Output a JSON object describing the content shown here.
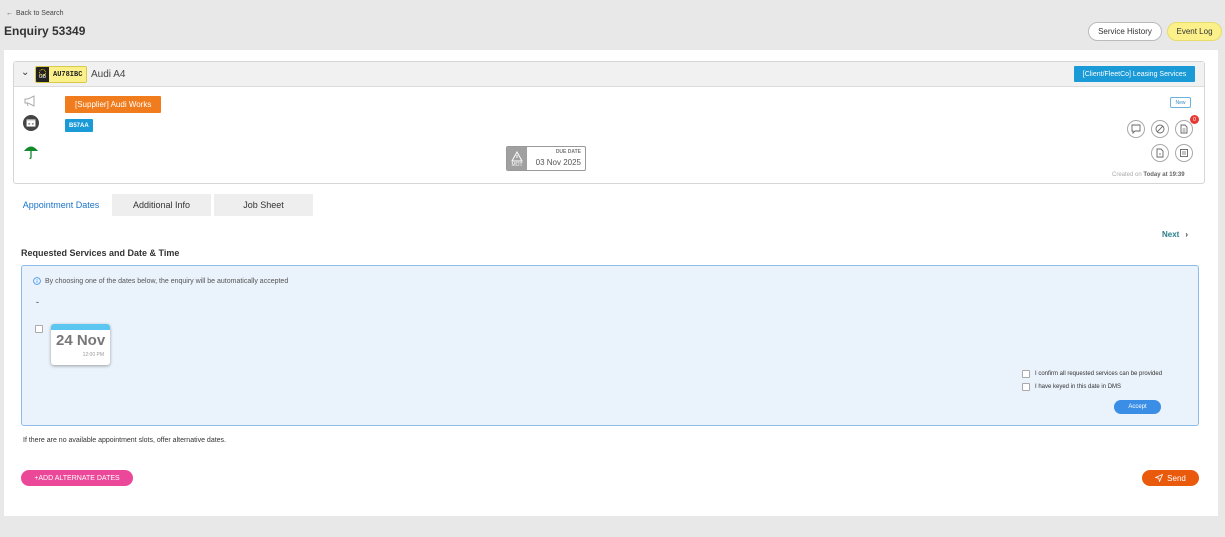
{
  "header": {
    "back_label": "Back to Search",
    "title": "Enquiry 53349",
    "service_history_label": "Service History",
    "event_log_label": "Event Log"
  },
  "vehicle": {
    "plate_country": "GB",
    "plate": "AU78IBC",
    "model": "Audi A4",
    "client_badge": "[Client/FleetCo] Leasing Services",
    "supplier": "[Supplier] Audi Works",
    "code": "B57AA",
    "mot": {
      "icon_label": "MOT",
      "due_label": "DUE DATE",
      "due_date": "03 Nov 2025"
    },
    "status_badge": "New",
    "notification_count": "0",
    "created_prefix": "Created on",
    "created_value": "Today at 19:39",
    "icons": [
      "megaphone-icon",
      "calendar-icon",
      "umbrella-icon",
      "comment-icon",
      "cancel-icon",
      "document-icon",
      "file-icon",
      "form-icon"
    ]
  },
  "tabs": [
    {
      "label": "Appointment Dates",
      "active": true
    },
    {
      "label": "Additional Info",
      "active": false
    },
    {
      "label": "Job Sheet",
      "active": false
    }
  ],
  "content": {
    "next_label": "Next",
    "section_title": "Requested Services and Date & Time",
    "info_text": "By choosing one of the dates below, the enquiry will be automatically accepted",
    "services_value": "-",
    "date": {
      "day_month": "24 Nov",
      "time": "12:00 PM"
    },
    "confirm_services_label": "I confirm all requested services can be provided",
    "keyed_dms_label": "I have keyed in this date in DMS",
    "accept_label": "Accept",
    "no_slots_text": "If there are no available appointment slots, offer alternative dates.",
    "add_alternate_label": "+ADD ALTERNATE DATES",
    "send_label": "Send"
  },
  "colors": {
    "supplier": "#f07c1d",
    "client": "#1a9ad6",
    "add_alternate": "#ec4899",
    "send": "#ea5a0c",
    "accept": "#3a8ee6"
  }
}
